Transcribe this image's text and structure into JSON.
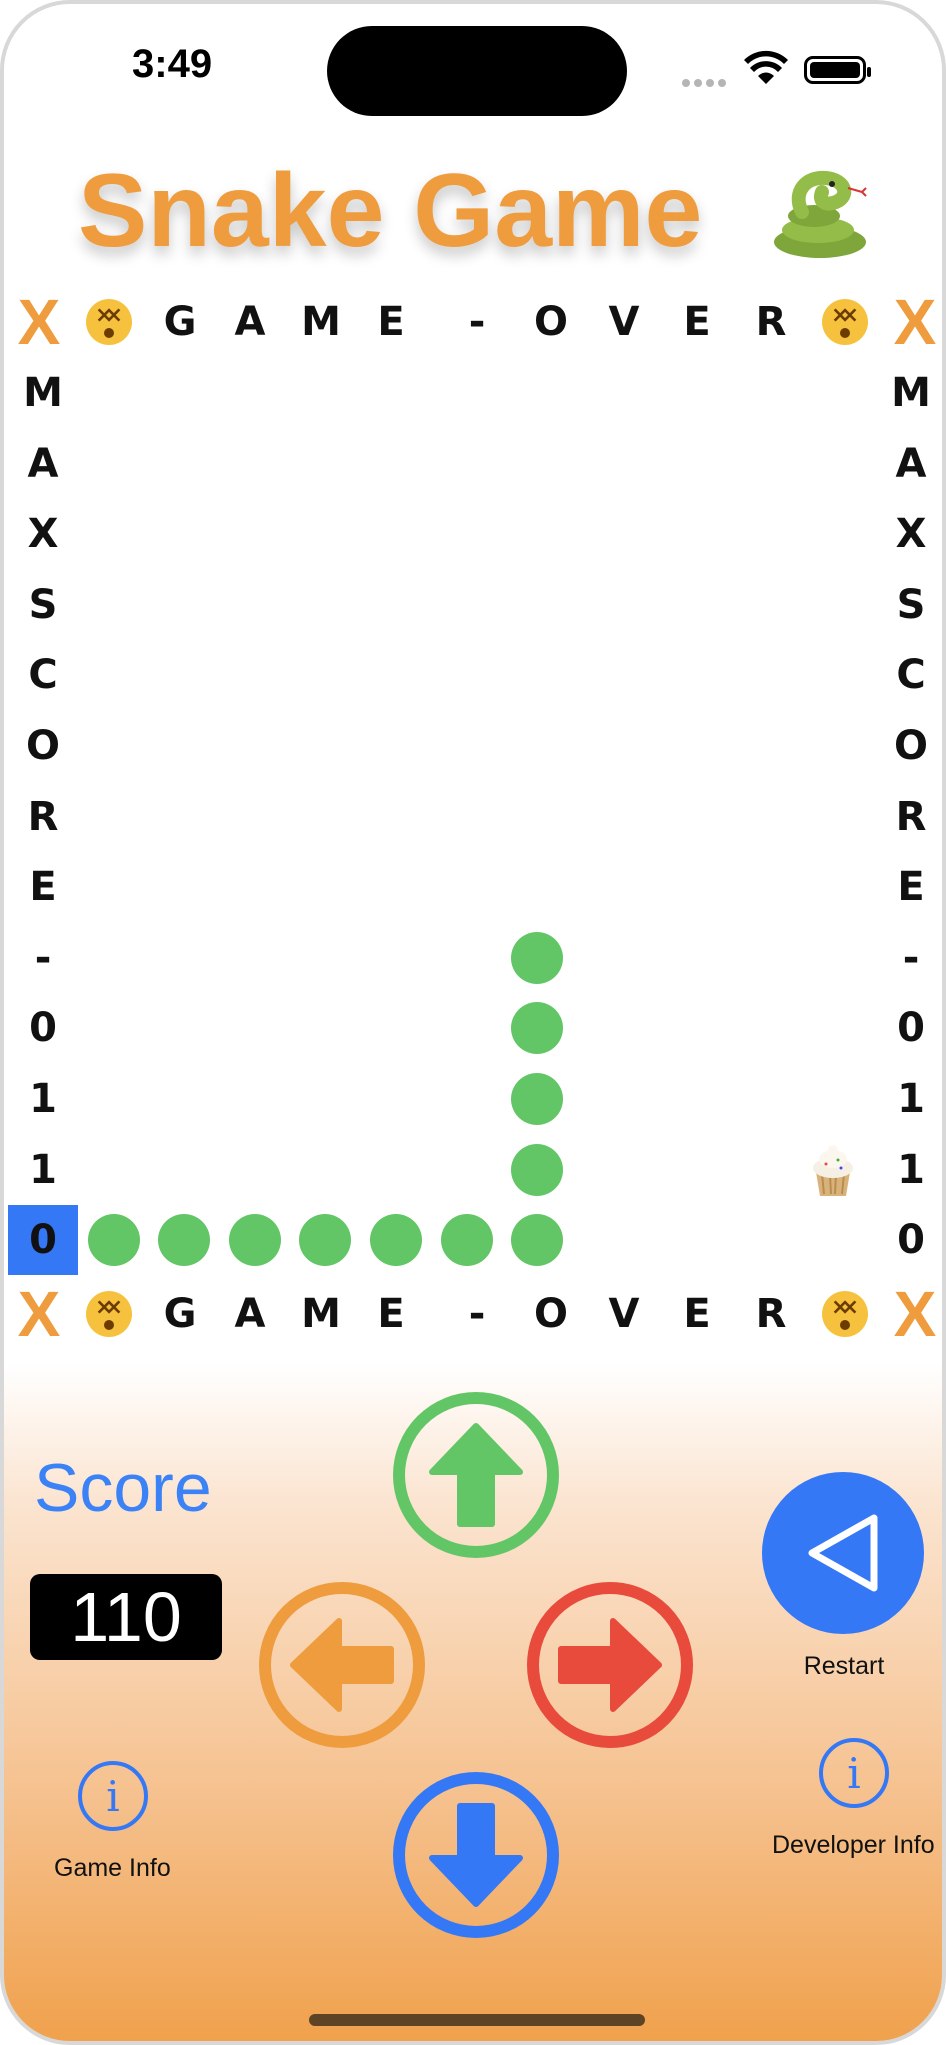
{
  "status_bar": {
    "time": "3:49"
  },
  "title": {
    "text": "Snake Game",
    "emoji_icon": "snake-emoji-icon"
  },
  "board": {
    "top_border": [
      "X",
      "😵",
      "G",
      "A",
      "M",
      "E",
      "-",
      "O",
      "V",
      "E",
      "R",
      "😵",
      "X"
    ],
    "bottom_border": [
      "X",
      "😵",
      "G",
      "A",
      "M",
      "E",
      "-",
      "O",
      "V",
      "E",
      "R",
      "😵",
      "X"
    ],
    "left_column": [
      "M",
      "A",
      "X",
      "S",
      "C",
      "O",
      "R",
      "E",
      "-",
      "0",
      "1",
      "1",
      "0"
    ],
    "right_column": [
      "M",
      "A",
      "X",
      "S",
      "C",
      "O",
      "R",
      "E",
      "-",
      "0",
      "1",
      "1",
      "0"
    ],
    "snake_color": "#63c666",
    "snake_cells": [
      [
        1,
        12
      ],
      [
        2,
        12
      ],
      [
        3,
        12
      ],
      [
        4,
        12
      ],
      [
        5,
        12
      ],
      [
        6,
        12
      ],
      [
        7,
        12
      ],
      [
        7,
        11
      ],
      [
        7,
        10
      ],
      [
        7,
        9
      ],
      [
        7,
        8
      ]
    ],
    "food": {
      "icon": "cupcake-icon",
      "cell": [
        11,
        11
      ]
    },
    "highlight_cell_color": "#3478f6"
  },
  "score": {
    "label": "Score",
    "value": "110"
  },
  "controls": {
    "up_icon": "up-arrow-icon",
    "left_icon": "left-arrow-icon",
    "right_icon": "right-arrow-icon",
    "down_icon": "down-arrow-icon",
    "up_color": "#63c666",
    "left_color": "#ef9c3e",
    "right_color": "#e84a3c",
    "down_color": "#3478f6"
  },
  "restart": {
    "label": "Restart",
    "icon": "play-triangle-icon"
  },
  "game_info": {
    "label": "Game Info",
    "icon": "info-icon"
  },
  "developer_info": {
    "label": "Developer Info",
    "icon": "info-icon"
  },
  "colors": {
    "accent_orange": "#ef9c3e",
    "accent_blue": "#3478f6"
  }
}
